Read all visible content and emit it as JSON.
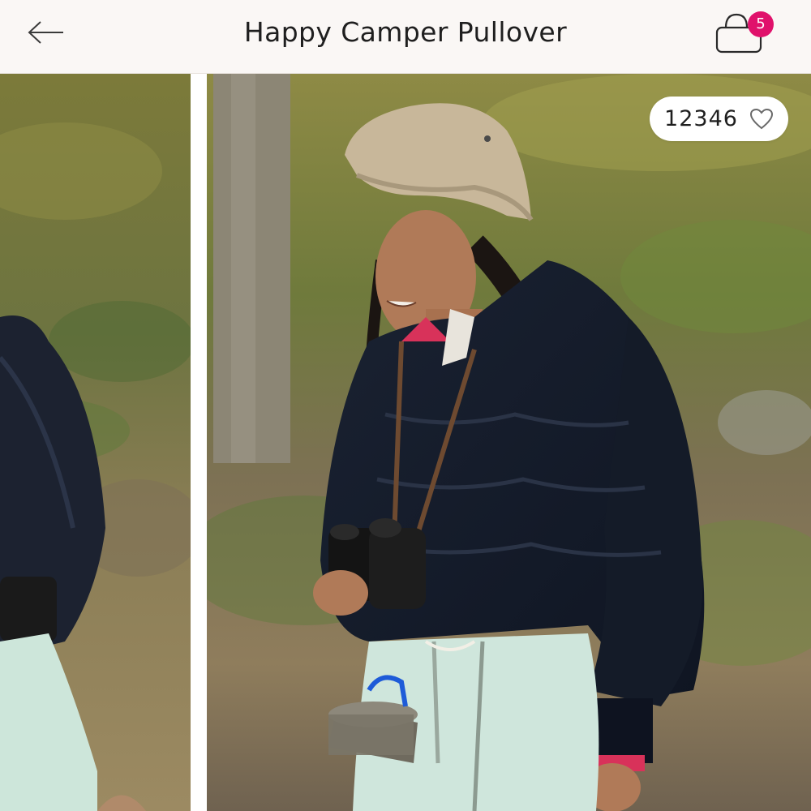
{
  "header": {
    "title": "Happy Camper Pullover",
    "back_icon": "arrow-left-icon",
    "bag_icon": "shopping-bag-icon",
    "bag_count": "5",
    "badge_color": "#e0116b"
  },
  "gallery": {
    "images": [
      {
        "name": "product-photo-side",
        "description_icon": "photo"
      },
      {
        "name": "product-photo-front",
        "description_icon": "photo"
      }
    ]
  },
  "like": {
    "count": "12346",
    "icon": "heart-outline-icon"
  }
}
